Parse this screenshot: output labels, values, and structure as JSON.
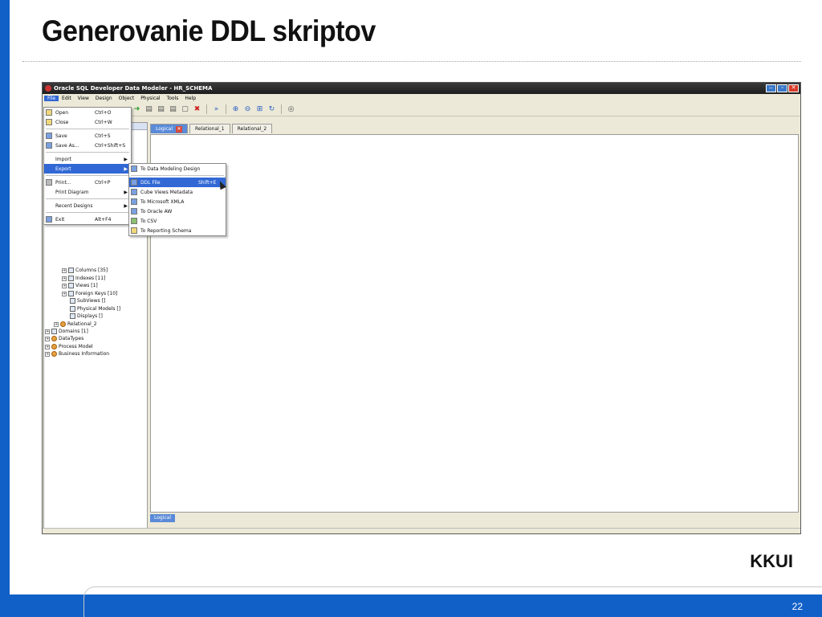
{
  "slide": {
    "title": "Generovanie DDL skriptov",
    "footer_mark": "KKUI",
    "page_number": "22"
  },
  "app": {
    "window_title": "Oracle SQL Developer Data Modeler - HR_SCHEMA",
    "menubar": [
      "File",
      "Edit",
      "View",
      "Design",
      "Object",
      "Physical",
      "Tools",
      "Help"
    ],
    "file_menu": {
      "open": {
        "label": "Open",
        "shortcut": "Ctrl+O"
      },
      "close": {
        "label": "Close",
        "shortcut": "Ctrl+W"
      },
      "save": {
        "label": "Save",
        "shortcut": "Ctrl+S"
      },
      "save_as": {
        "label": "Save As...",
        "shortcut": "Ctrl+Shift+S"
      },
      "import": {
        "label": "Import"
      },
      "export": {
        "label": "Export"
      },
      "print": {
        "label": "Print...",
        "shortcut": "Ctrl+P"
      },
      "print_diagram": {
        "label": "Print Diagram"
      },
      "recent_designs": {
        "label": "Recent Designs"
      },
      "exit": {
        "label": "Exit",
        "shortcut": "Alt+F4"
      }
    },
    "export_menu": {
      "to_data_modeling_design": "To Data Modeling Design",
      "ddl_file": {
        "label": "DDL File",
        "shortcut": "Shift+E"
      },
      "cube_views_metadata": "Cube Views Metadata",
      "to_microsoft_xmla": "To Microsoft XMLA",
      "to_oracle_aw": "To Oracle AW",
      "to_csv": "To CSV",
      "to_reporting_schema": "To Reporting Schema"
    },
    "tree": {
      "columns": "Columns [35]",
      "indexes": "Indexes [11]",
      "views": "Views [1]",
      "foreign_keys": "Foreign Keys [10]",
      "subviews": "SubViews []",
      "physical_models": "Physical Models []",
      "displays": "Displays []",
      "relational_2": "Relational_2",
      "domains": "Domains [1]",
      "datatypes": "DataTypes",
      "process_model": "Process Model",
      "business_information": "Business Information"
    },
    "tabs": [
      "Logical",
      "Relational_1",
      "Relational_2"
    ],
    "bottom_tab": "Logical",
    "colors": {
      "accent": "#3168d5",
      "slide_blue": "#1060c8"
    }
  }
}
